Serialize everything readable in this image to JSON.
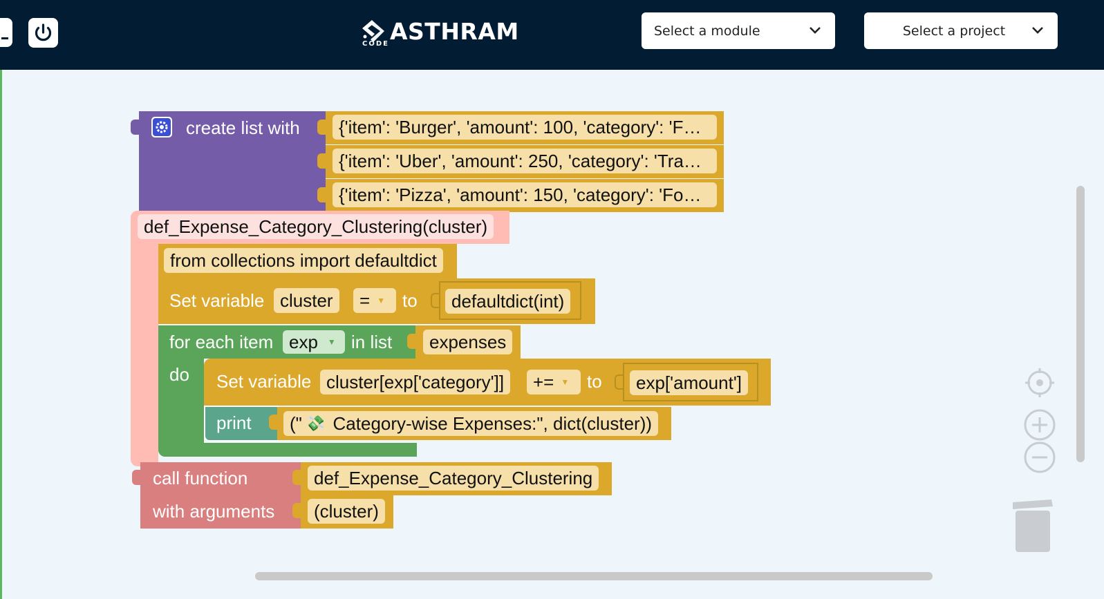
{
  "header": {
    "brand": "ASTHRAM",
    "brand_sub": "CODE",
    "module_select": {
      "value": "Select a module"
    },
    "project_select": {
      "value": "Select a project"
    }
  },
  "blocks": {
    "create_list": {
      "label": "create list with",
      "items": [
        "{'item': 'Burger', 'amount': 100, 'category': 'F…",
        "{'item': 'Uber', 'amount': 250, 'category': 'Tra…",
        "{'item': 'Pizza', 'amount': 150, 'category': 'Fo…"
      ]
    },
    "def_block": {
      "label": "def_Expense_Category_Clustering(cluster)"
    },
    "import_block": {
      "label": "from collections import defaultdict"
    },
    "set_var_1": {
      "label": "Set variable",
      "var": "cluster",
      "op": "=",
      "to": "to",
      "value": "defaultdict(int)"
    },
    "for_each": {
      "label": "for each item",
      "var": "exp",
      "in_list": "in list",
      "list": "expenses",
      "do": "do"
    },
    "set_var_2": {
      "label": "Set variable",
      "var": "cluster[exp['category']]",
      "op": "+=",
      "to": "to",
      "value": "exp['amount']"
    },
    "print_block": {
      "label": "print",
      "value_prefix": "(\"",
      "emoji": "💸",
      "value_suffix": " Category-wise Expenses:\", dict(cluster))"
    },
    "call_function": {
      "label1": "call function",
      "label2": "with arguments",
      "name": "def_Expense_Category_Clustering",
      "args": "(cluster)"
    }
  },
  "colors": {
    "header_bg": "#021c33",
    "workspace_bg": "#eef6fc",
    "list_block": "#745ca8",
    "value_block": "#dba82c",
    "def_block": "#ffbcb4",
    "loop_block": "#5ba55b",
    "print_block": "#5ba58c",
    "call_block": "#d97f80"
  }
}
